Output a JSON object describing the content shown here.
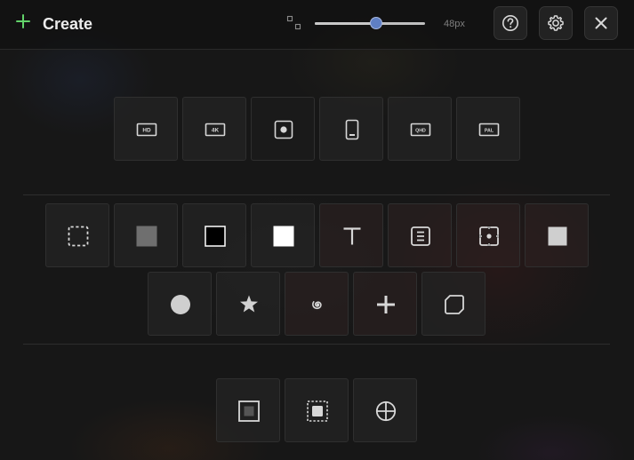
{
  "header": {
    "title": "Create",
    "size_value": "48px",
    "slider_fraction": 0.56,
    "accent_color": "#62d36a",
    "slider_thumb_color": "#5f7fc4",
    "plus_icon": "plus-icon",
    "size_icon": "resize-icon",
    "help_icon": "help-icon",
    "settings_icon": "gear-icon",
    "close_icon": "close-icon"
  },
  "sections": {
    "resolutions": [
      "hd-icon",
      "4k-icon",
      "record-icon",
      "phone-icon",
      "qhd-icon",
      "pal-icon"
    ],
    "tools_row_1": [
      "dashed-rect-icon",
      "gray-square-icon",
      "black-square-icon",
      "white-square-icon",
      "text-icon",
      "text-box-icon",
      "dot-frame-icon",
      "light-square-icon"
    ],
    "tools_row_2": [
      "circle-icon",
      "star-icon",
      "spiral-icon",
      "cross-icon",
      "rounded-square-icon"
    ],
    "bottom_tools": [
      "inner-square-icon",
      "dashed-inner-square-icon",
      "crosshair-icon"
    ],
    "resolution_labels": {
      "hd": "HD",
      "4k": "4K",
      "qhd": "QHD",
      "pal": "PAL"
    }
  }
}
